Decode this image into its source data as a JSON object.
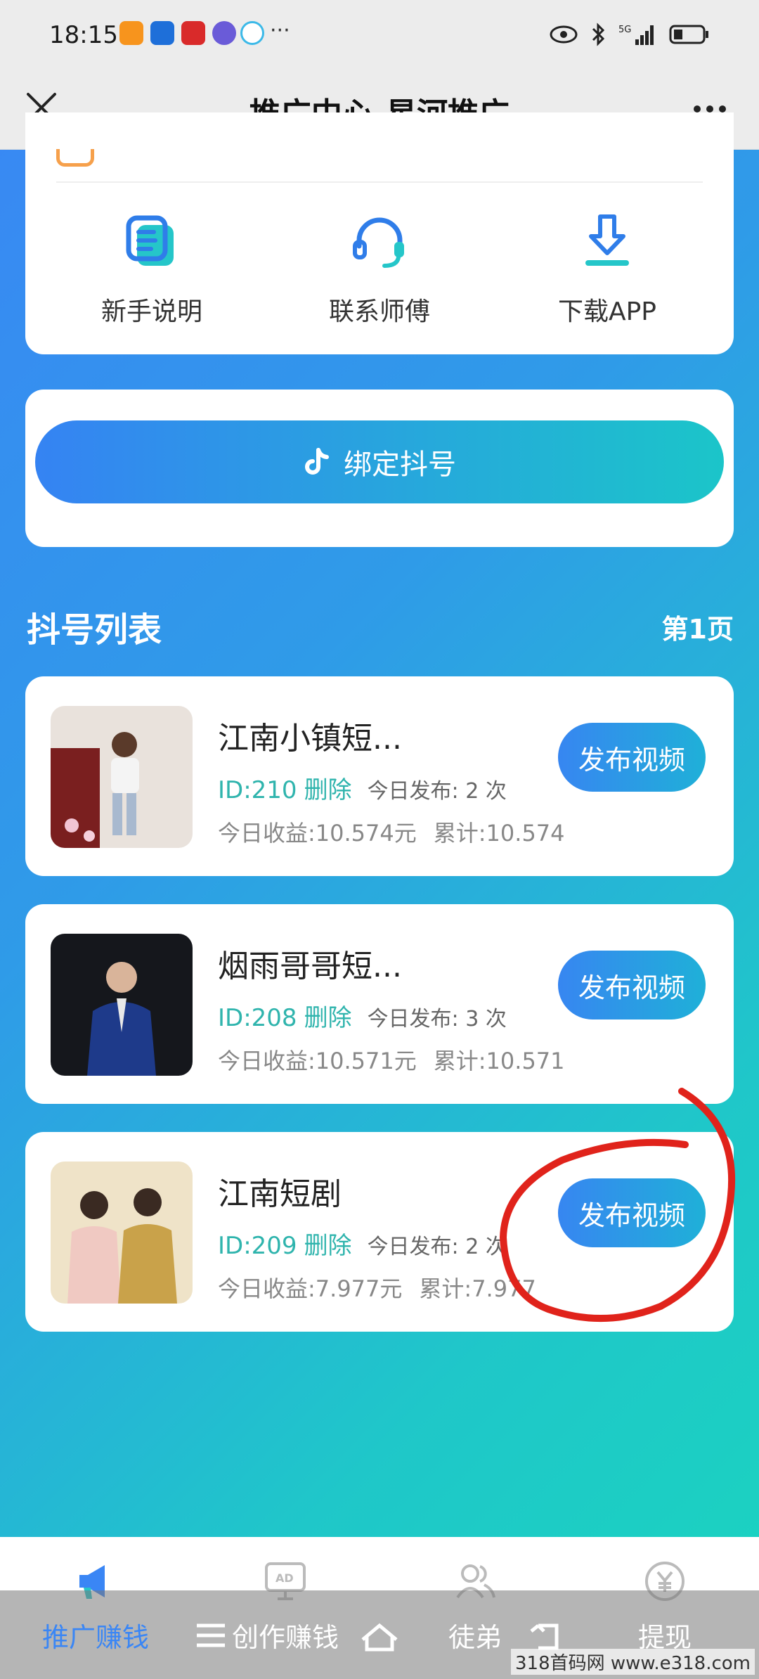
{
  "status_bar": {
    "time": "18:15",
    "more": "···"
  },
  "header": {
    "title": "推广中心-星河推广"
  },
  "quick_links": [
    {
      "label": "新手说明",
      "icon": "guide-icon"
    },
    {
      "label": "联系师傅",
      "icon": "headset-icon"
    },
    {
      "label": "下载APP",
      "icon": "download-icon"
    }
  ],
  "bind_button": {
    "label": "绑定抖号"
  },
  "list": {
    "title": "抖号列表",
    "page": "第1页"
  },
  "accounts": [
    {
      "name": "江南小镇短...",
      "id": "ID:210",
      "delete": "删除",
      "published": "今日发布: 2 次",
      "income": "今日收益:10.574元",
      "total": "累计:10.574",
      "button": "发布视频"
    },
    {
      "name": "烟雨哥哥短...",
      "id": "ID:208",
      "delete": "删除",
      "published": "今日发布: 3 次",
      "income": "今日收益:10.571元",
      "total": "累计:10.571",
      "button": "发布视频"
    },
    {
      "name": "江南短剧",
      "id": "ID:209",
      "delete": "删除",
      "published": "今日发布: 2 次",
      "income": "今日收益:7.977元",
      "total": "累计:7.977",
      "button": "发布视频"
    }
  ],
  "bottom_nav": [
    {
      "label": "推广赚钱",
      "icon": "megaphone-icon",
      "active": true
    },
    {
      "label": "创作赚钱",
      "icon": "ad-icon",
      "active": false
    },
    {
      "label": "徒弟",
      "icon": "users-icon",
      "active": false
    },
    {
      "label": "提现",
      "icon": "yuan-icon",
      "active": false
    }
  ],
  "watermark": "318首码网 www.e318.com",
  "colors": {
    "accent": "#3a86f5",
    "teal": "#1fc7c9",
    "id_text": "#2fb4ad",
    "annotation": "#e0231b"
  }
}
